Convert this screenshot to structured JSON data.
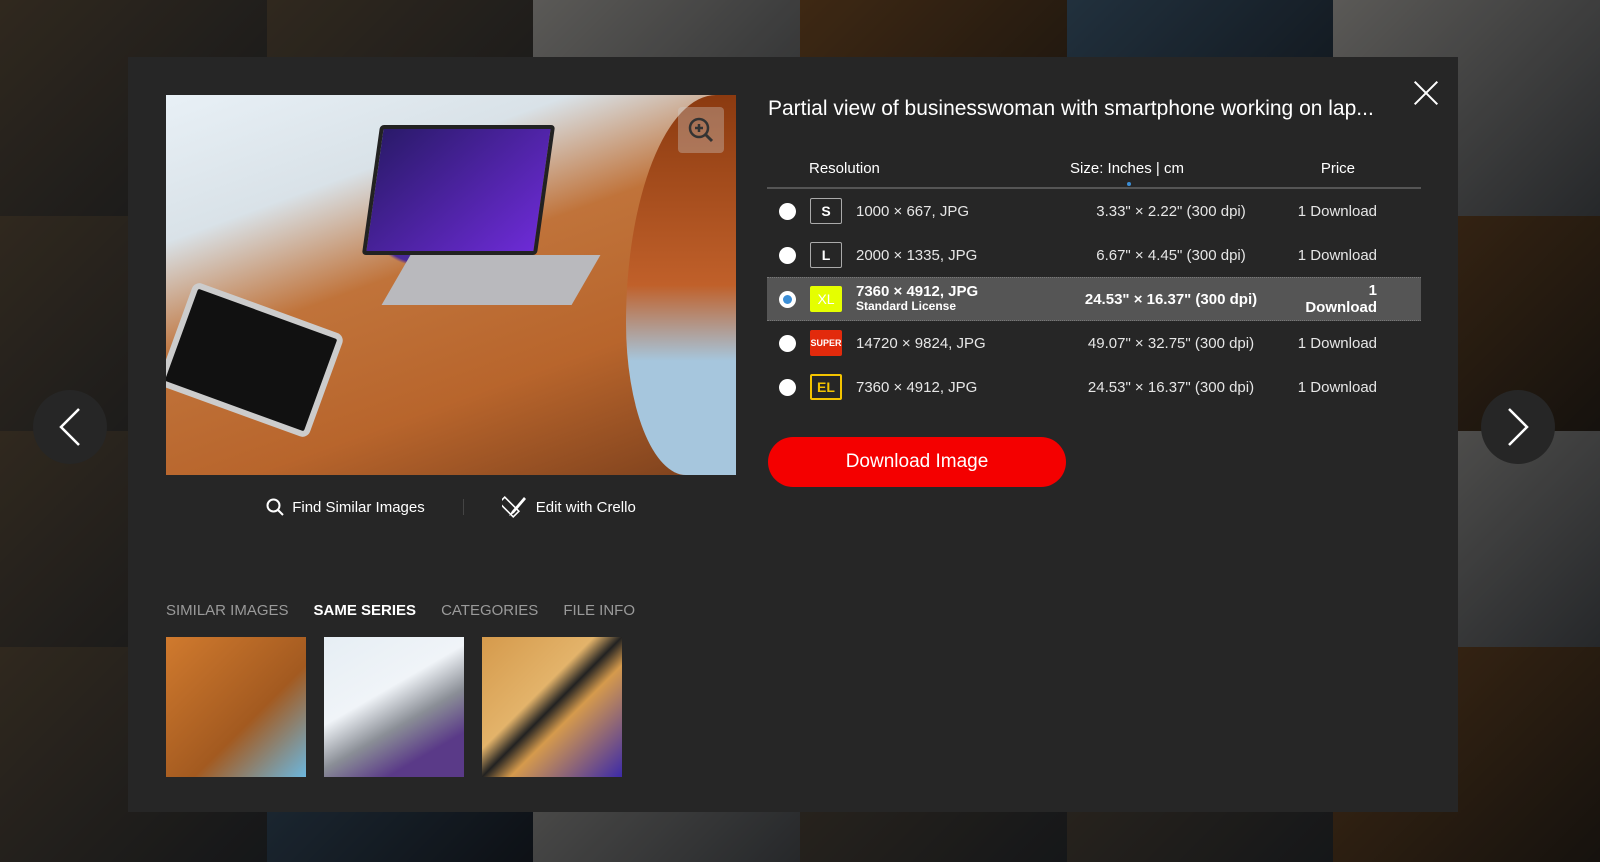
{
  "modal": {
    "title": "Partial view of businesswoman with smartphone working on lap...",
    "close_icon": "close-icon",
    "zoom_icon": "zoom-in-icon"
  },
  "actions": {
    "find_similar": "Find Similar Images",
    "edit_crello": "Edit with Crello"
  },
  "table": {
    "headers": {
      "resolution": "Resolution",
      "size": "Size: Inches | cm",
      "price": "Price"
    },
    "rows": [
      {
        "badge": "S",
        "resolution": "1000 × 667, JPG",
        "license": "",
        "size": "3.33\" × 2.22\" (300 dpi)",
        "price": "1 Download",
        "selected": false
      },
      {
        "badge": "L",
        "resolution": "2000 × 1335, JPG",
        "license": "",
        "size": "6.67\" × 4.45\" (300 dpi)",
        "price": "1 Download",
        "selected": false
      },
      {
        "badge": "XL",
        "resolution": "7360 × 4912, JPG",
        "license": "Standard License",
        "size": "24.53\" × 16.37\" (300 dpi)",
        "price": "1 Download",
        "selected": true
      },
      {
        "badge": "SUPER",
        "resolution": "14720 × 9824, JPG",
        "license": "",
        "size": "49.07\" × 32.75\" (300 dpi)",
        "price": "1 Download",
        "selected": false
      },
      {
        "badge": "EL",
        "resolution": "7360 × 4912, JPG",
        "license": "",
        "size": "24.53\" × 16.37\" (300 dpi)",
        "price": "1 Download",
        "selected": false
      }
    ]
  },
  "download_button": "Download Image",
  "tabs": [
    {
      "label": "Similar Images",
      "active": false
    },
    {
      "label": "Same Series",
      "active": true
    },
    {
      "label": "Categories",
      "active": false
    },
    {
      "label": "File Info",
      "active": false
    }
  ],
  "colors": {
    "accent": "#f40000",
    "radio_selected": "#3b8ed6",
    "xl_badge": "#e5ff00",
    "super_badge": "#e22a0c",
    "el_badge": "#f4c400"
  }
}
